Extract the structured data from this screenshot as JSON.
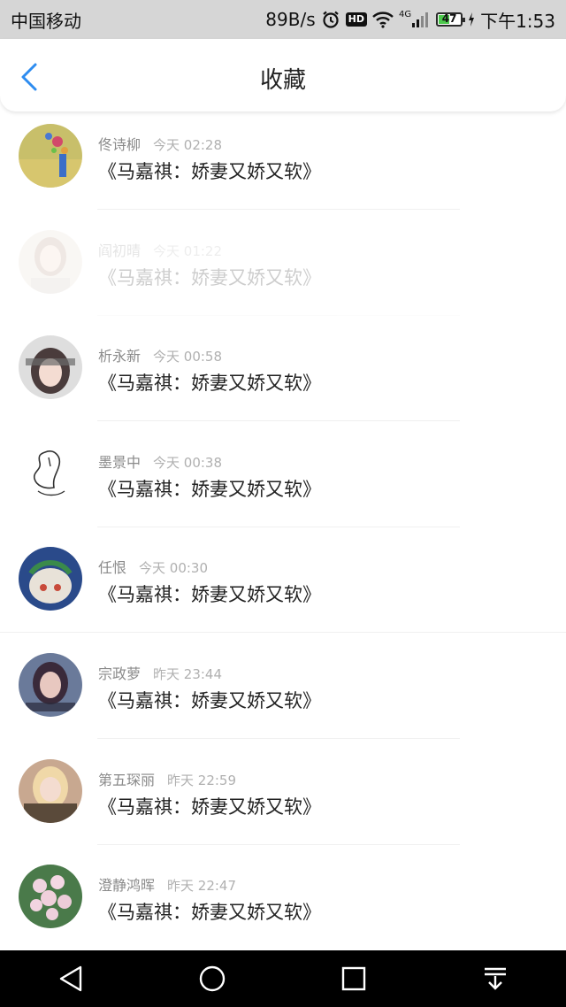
{
  "status_bar": {
    "carrier": "中国移动",
    "speed": "89B/s",
    "hd": "HD",
    "network": "4G",
    "battery": "47",
    "time": "下午1:53"
  },
  "header": {
    "title": "收藏"
  },
  "items": [
    {
      "name": "佟诗柳",
      "time": "今天 02:28",
      "book": "《马嘉祺：娇妻又娇又软》"
    },
    {
      "name": "阎初晴",
      "time": "今天 01:22",
      "book": "《马嘉祺：娇妻又娇又软》"
    },
    {
      "name": "析永新",
      "time": "今天 00:58",
      "book": "《马嘉祺：娇妻又娇又软》"
    },
    {
      "name": "墨景中",
      "time": "今天 00:38",
      "book": "《马嘉祺：娇妻又娇又软》"
    },
    {
      "name": "任恨",
      "time": "今天 00:30",
      "book": "《马嘉祺：娇妻又娇又软》"
    },
    {
      "name": "宗政萝",
      "time": "昨天 23:44",
      "book": "《马嘉祺：娇妻又娇又软》"
    },
    {
      "name": "第五琛丽",
      "time": "昨天 22:59",
      "book": "《马嘉祺：娇妻又娇又软》"
    },
    {
      "name": "澄静鸿晖",
      "time": "昨天 22:47",
      "book": "《马嘉祺：娇妻又娇又软》"
    }
  ],
  "colors": {
    "accent": "#2d8cf0",
    "status_bar_bg": "#d6d6d6",
    "nav_bar_bg": "#000000"
  }
}
